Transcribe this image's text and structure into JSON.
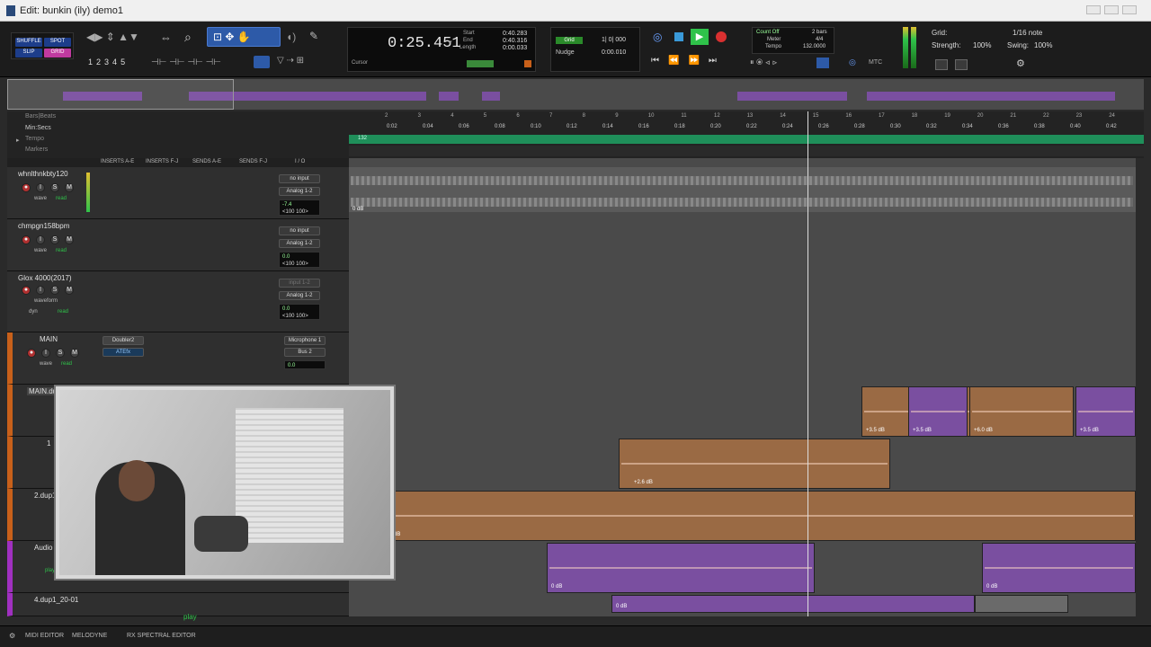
{
  "window": {
    "title": "Edit: bunkin (ily) demo1"
  },
  "edit_modes": [
    "SHUFFLE",
    "SPOT",
    "SLIP",
    "GRID"
  ],
  "zoom_presets": [
    "1",
    "2",
    "3",
    "4",
    "5"
  ],
  "counter": {
    "main": "0:25.451",
    "start_label": "Start",
    "start": "0:40.283",
    "end_label": "End",
    "end": "0:40.316",
    "length_label": "Length",
    "length": "0:00.033",
    "cursor_label": "Cursor"
  },
  "grid_nudge": {
    "grid_label": "Grid",
    "grid_value": "1| 0| 000",
    "nudge_label": "Nudge",
    "nudge_value": "0:00.010"
  },
  "meter_tempo": {
    "count_off": "Count Off",
    "count_off_value": "2 bars",
    "meter": "Meter",
    "meter_value": "4/4",
    "tempo": "Tempo",
    "tempo_value": "132.0000"
  },
  "grid_panel": {
    "grid_label": "Grid:",
    "grid_value": "1/16 note",
    "strength_label": "Strength:",
    "strength_value": "100%",
    "swing_label": "Swing:",
    "swing_value": "100%"
  },
  "mtc_label": "MTC",
  "rulers": {
    "bars_beats": "Bars|Beats",
    "min_secs": "Min:Secs",
    "tempo": "Tempo",
    "markers": "Markers",
    "bars": [
      "2",
      "3",
      "4",
      "5",
      "6",
      "7",
      "8",
      "9",
      "10",
      "11",
      "12",
      "13",
      "14",
      "15",
      "16",
      "17",
      "18",
      "19",
      "20",
      "21",
      "22",
      "23",
      "24"
    ],
    "secs": [
      "0:02",
      "0:04",
      "0:06",
      "0:08",
      "0:10",
      "0:12",
      "0:14",
      "0:16",
      "0:18",
      "0:20",
      "0:22",
      "0:24",
      "0:26",
      "0:28",
      "0:30",
      "0:32",
      "0:34",
      "0:36",
      "0:38",
      "0:40",
      "0:42"
    ],
    "tempo_value": "132"
  },
  "column_headers": [
    "INSERTS A-E",
    "INSERTS F-J",
    "SENDS A-E",
    "SENDS F-J",
    "I / O"
  ],
  "tracks": [
    {
      "name": "whnlthnkbty120",
      "input": "no input",
      "output": "Analog 1-2",
      "vol": "-7.4",
      "pan": "<100  100>",
      "view": "wave",
      "auto": "read"
    },
    {
      "name": "chmpgn158bpm",
      "input": "no input",
      "output": "Analog 1-2",
      "vol": "0.0",
      "pan": "<100  100>",
      "view": "wave",
      "auto": "read"
    },
    {
      "name": "Glox 4000(2017)",
      "input": "input 1-2",
      "output": "Analog 1-2",
      "vol": "0.0",
      "pan": "<100  100>",
      "view": "waveform",
      "auto": "read",
      "extra": "dyn"
    },
    {
      "name": "MAIN",
      "input": "Microphone 1",
      "output": "Bus 2",
      "vol": "0.0",
      "insert1": "Doubler2",
      "insert2": "ATEfx",
      "view": "wave",
      "auto": "read"
    },
    {
      "name": "MAIN.dup1"
    },
    {
      "name": "1"
    },
    {
      "name": "2.dup1"
    },
    {
      "name": "Audio 2",
      "auto": "play"
    },
    {
      "name": "4.dup1_20-01"
    }
  ],
  "clip_gains": [
    "0 dB",
    "+3.5 dB",
    "+3.5 dB",
    "+6.0 dB",
    "+3.5 dB",
    "+2.6 dB",
    "0 dB",
    "0 dB",
    "0 dB",
    "0 dB"
  ],
  "status": {
    "play": "play"
  },
  "bottom_tabs": [
    "MIDI EDITOR",
    "MELODYNE",
    "RX SPECTRAL EDITOR"
  ],
  "colors": {
    "orange_clip": "#9a6a44",
    "purple_clip": "#7a4fa0",
    "green_play": "#2fc24a",
    "record_red": "#d93030"
  }
}
